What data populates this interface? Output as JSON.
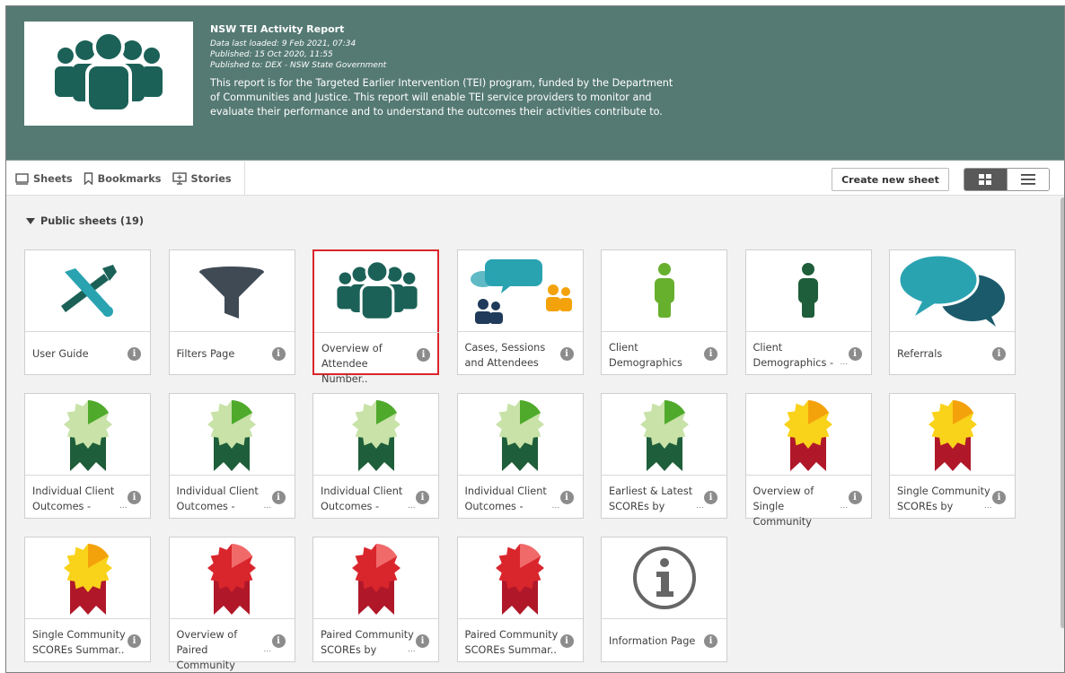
{
  "app": {
    "title": "NSW TEI Activity Report",
    "meta": [
      "Data last loaded: 9 Feb 2021, 07:34",
      "Published: 15 Oct 2020, 11:55",
      "Published to: DEX - NSW State Government"
    ],
    "description": [
      "This report is for the Targeted Earlier Intervention (TEI) program, funded by the Department",
      "of Communities and Justice. This report will enable TEI service providers to monitor and",
      "evaluate their performance and to understand the outcomes their activities contribute to."
    ]
  },
  "tabs": {
    "sheets": "Sheets",
    "bookmarks": "Bookmarks",
    "stories": "Stories"
  },
  "toolbar": {
    "create_label": "Create new sheet"
  },
  "section": {
    "title": "Public sheets (19)"
  },
  "colors": {
    "header_bg": "#557a73",
    "selected_border": "#d9262c",
    "teal": "#1b6157",
    "cyan": "#2aa3b1",
    "green": "#67b02e",
    "dark_green": "#1e5e3a",
    "yellow": "#f9d21a",
    "red": "#d9262c",
    "maroon": "#b0182a"
  },
  "sheets": [
    {
      "lines": [
        "User Guide"
      ],
      "icon": "tools-icon",
      "truncated": false
    },
    {
      "lines": [
        "Filters Page"
      ],
      "icon": "funnel-icon",
      "truncated": false
    },
    {
      "lines": [
        "Overview of",
        "Attendee Number.."
      ],
      "icon": "people-group-icon",
      "truncated": false,
      "selected": true
    },
    {
      "lines": [
        "Cases, Sessions",
        "and Attendees"
      ],
      "icon": "chat-people-icon",
      "truncated": false
    },
    {
      "lines": [
        "Client",
        "Demographics"
      ],
      "icon": "person-green-icon",
      "truncated": false
    },
    {
      "lines": [
        "Client",
        "Demographics -"
      ],
      "icon": "person-darkgreen-icon",
      "truncated": true
    },
    {
      "lines": [
        "Referrals"
      ],
      "icon": "speech-bubbles-icon",
      "truncated": false
    },
    {
      "lines": [
        "Individual Client",
        "Outcomes -"
      ],
      "icon": "green-rosette-icon",
      "truncated": true
    },
    {
      "lines": [
        "Individual Client",
        "Outcomes -"
      ],
      "icon": "green-rosette-icon",
      "truncated": true
    },
    {
      "lines": [
        "Individual Client",
        "Outcomes -"
      ],
      "icon": "green-rosette-icon",
      "truncated": true
    },
    {
      "lines": [
        "Individual Client",
        "Outcomes -"
      ],
      "icon": "green-rosette-icon",
      "truncated": true
    },
    {
      "lines": [
        "Earliest & Latest",
        "SCOREs by"
      ],
      "icon": "green-rosette-icon",
      "truncated": true
    },
    {
      "lines": [
        "Overview of Single",
        "Community"
      ],
      "icon": "yellow-rosette-icon",
      "truncated": true
    },
    {
      "lines": [
        "Single Community",
        "SCOREs by"
      ],
      "icon": "yellow-rosette-icon",
      "truncated": true
    },
    {
      "lines": [
        "Single Community",
        "SCOREs Summar.."
      ],
      "icon": "yellow-rosette-icon",
      "truncated": false
    },
    {
      "lines": [
        "Overview of Paired",
        "Community"
      ],
      "icon": "red-rosette-icon",
      "truncated": true
    },
    {
      "lines": [
        "Paired Community",
        "SCOREs by"
      ],
      "icon": "red-rosette-icon",
      "truncated": true
    },
    {
      "lines": [
        "Paired Community",
        "SCOREs Summar.."
      ],
      "icon": "red-rosette-icon",
      "truncated": false
    },
    {
      "lines": [
        "Information Page"
      ],
      "icon": "info-circle-icon",
      "truncated": false
    }
  ]
}
